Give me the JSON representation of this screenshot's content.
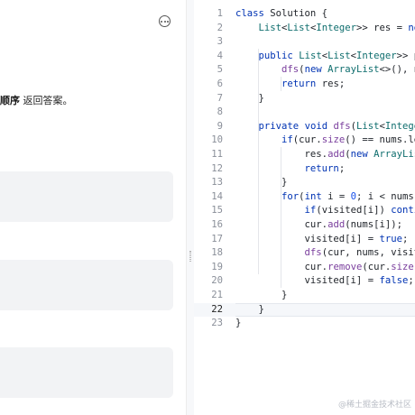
{
  "problem": {
    "description_bold": "顺序",
    "description_rest": " 返回答案。"
  },
  "editor": {
    "lines": [
      {
        "num": "1",
        "tokens": [
          [
            "kw",
            "class"
          ],
          [
            "p",
            " Solution {"
          ]
        ]
      },
      {
        "num": "2",
        "tokens": [
          [
            "p",
            "    "
          ],
          [
            "ty",
            "List"
          ],
          [
            "p",
            "<"
          ],
          [
            "ty",
            "List"
          ],
          [
            "p",
            "<"
          ],
          [
            "ty",
            "Integer"
          ],
          [
            "p",
            ">> res = "
          ],
          [
            "kw",
            "new"
          ]
        ]
      },
      {
        "num": "3",
        "tokens": []
      },
      {
        "num": "4",
        "tokens": [
          [
            "p",
            "    "
          ],
          [
            "kw",
            "public"
          ],
          [
            "p",
            " "
          ],
          [
            "ty",
            "List"
          ],
          [
            "p",
            "<"
          ],
          [
            "ty",
            "List"
          ],
          [
            "p",
            "<"
          ],
          [
            "ty",
            "Integer"
          ],
          [
            "p",
            ">> pe"
          ]
        ]
      },
      {
        "num": "5",
        "tokens": [
          [
            "p",
            "        "
          ],
          [
            "fn",
            "dfs"
          ],
          [
            "p",
            "("
          ],
          [
            "kw",
            "new"
          ],
          [
            "p",
            " "
          ],
          [
            "ty",
            "ArrayList"
          ],
          [
            "p",
            "<>(), nu"
          ]
        ]
      },
      {
        "num": "6",
        "tokens": [
          [
            "p",
            "        "
          ],
          [
            "kw",
            "return"
          ],
          [
            "p",
            " res;"
          ]
        ]
      },
      {
        "num": "7",
        "tokens": [
          [
            "p",
            "    }"
          ]
        ]
      },
      {
        "num": "8",
        "tokens": []
      },
      {
        "num": "9",
        "tokens": [
          [
            "p",
            "    "
          ],
          [
            "kw",
            "private"
          ],
          [
            "p",
            " "
          ],
          [
            "kw",
            "void"
          ],
          [
            "p",
            " "
          ],
          [
            "fn",
            "dfs"
          ],
          [
            "p",
            "("
          ],
          [
            "ty",
            "List"
          ],
          [
            "p",
            "<"
          ],
          [
            "ty",
            "Integer"
          ]
        ]
      },
      {
        "num": "10",
        "tokens": [
          [
            "p",
            "        "
          ],
          [
            "kw",
            "if"
          ],
          [
            "p",
            "(cur."
          ],
          [
            "fn",
            "size"
          ],
          [
            "p",
            "() == nums.len"
          ]
        ]
      },
      {
        "num": "11",
        "tokens": [
          [
            "p",
            "            res."
          ],
          [
            "fn",
            "add"
          ],
          [
            "p",
            "("
          ],
          [
            "kw",
            "new"
          ],
          [
            "p",
            " "
          ],
          [
            "ty",
            "ArrayList"
          ]
        ]
      },
      {
        "num": "12",
        "tokens": [
          [
            "p",
            "            "
          ],
          [
            "kw",
            "return"
          ],
          [
            "p",
            ";"
          ]
        ]
      },
      {
        "num": "13",
        "tokens": [
          [
            "p",
            "        }"
          ]
        ]
      },
      {
        "num": "14",
        "tokens": [
          [
            "p",
            "        "
          ],
          [
            "kw",
            "for"
          ],
          [
            "p",
            "("
          ],
          [
            "kw",
            "int"
          ],
          [
            "p",
            " i = "
          ],
          [
            "nm",
            "0"
          ],
          [
            "p",
            "; i < nums.l"
          ]
        ]
      },
      {
        "num": "15",
        "tokens": [
          [
            "p",
            "            "
          ],
          [
            "kw",
            "if"
          ],
          [
            "p",
            "(visited[i]) "
          ],
          [
            "kw",
            "contin"
          ]
        ]
      },
      {
        "num": "16",
        "tokens": [
          [
            "p",
            "            cur."
          ],
          [
            "fn",
            "add"
          ],
          [
            "p",
            "(nums[i]);"
          ]
        ]
      },
      {
        "num": "17",
        "tokens": [
          [
            "p",
            "            visited[i] = "
          ],
          [
            "kw",
            "true"
          ],
          [
            "p",
            ";"
          ]
        ]
      },
      {
        "num": "18",
        "tokens": [
          [
            "p",
            "            "
          ],
          [
            "fn",
            "dfs"
          ],
          [
            "p",
            "(cur, nums, visite"
          ]
        ]
      },
      {
        "num": "19",
        "tokens": [
          [
            "p",
            "            cur."
          ],
          [
            "fn",
            "remove"
          ],
          [
            "p",
            "(cur."
          ],
          [
            "fn",
            "size"
          ],
          [
            "p",
            "()"
          ]
        ]
      },
      {
        "num": "20",
        "tokens": [
          [
            "p",
            "            visited[i] = "
          ],
          [
            "kw",
            "false"
          ],
          [
            "p",
            ";"
          ]
        ]
      },
      {
        "num": "21",
        "tokens": [
          [
            "p",
            "        }"
          ]
        ]
      },
      {
        "num": "22",
        "tokens": [
          [
            "p",
            "    }"
          ]
        ]
      },
      {
        "num": "23",
        "tokens": [
          [
            "p",
            "}"
          ]
        ]
      }
    ],
    "active_line": 22
  },
  "watermark": "@稀土掘金技术社区",
  "icons": {
    "more": "more-horizontal-icon"
  }
}
